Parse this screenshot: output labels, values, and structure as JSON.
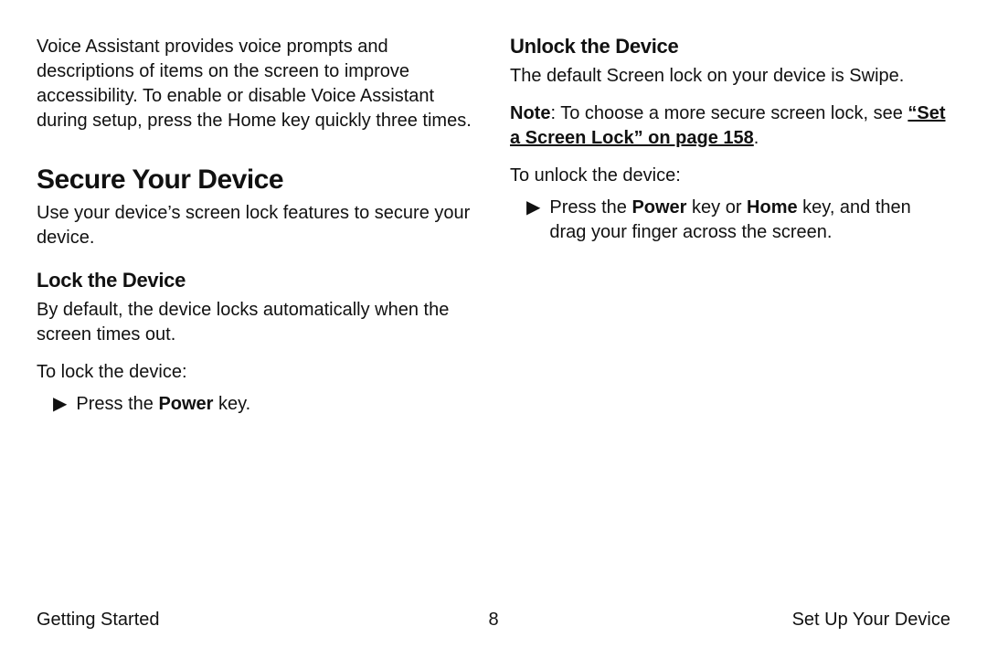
{
  "left": {
    "intro_paragraph": "Voice Assistant provides voice prompts and descriptions of items on the screen to improve accessibility. To enable or disable Voice Assistant during setup, press the Home key quickly three times.",
    "h1": "Secure Your Device",
    "secure_paragraph": "Use your device’s screen lock features to secure your device.",
    "h2_lock": "Lock the Device",
    "lock_para": "By default, the device locks automatically when the screen times out.",
    "lock_instr_label": "To lock the device:",
    "lock_step_prefix": "Press the ",
    "lock_step_bold": "Power",
    "lock_step_suffix": " key."
  },
  "right": {
    "h2_unlock": "Unlock the Device",
    "unlock_para": "The default Screen lock on your device is Swipe.",
    "note_label": "Note",
    "note_text": ": To choose a more secure screen lock, see ",
    "note_link": "“Set a Screen Lock” on page 158",
    "note_after": ".",
    "unlock_instr_label": "To unlock the device:",
    "unlock_step_prefix": "Press the ",
    "unlock_step_bold1": "Power",
    "unlock_step_mid": " key or ",
    "unlock_step_bold2": "Home",
    "unlock_step_suffix": " key, and then drag your finger across the screen."
  },
  "footer": {
    "left": "Getting Started",
    "center": "8",
    "right": "Set Up Your Device"
  },
  "glyphs": {
    "arrow": "▶"
  }
}
